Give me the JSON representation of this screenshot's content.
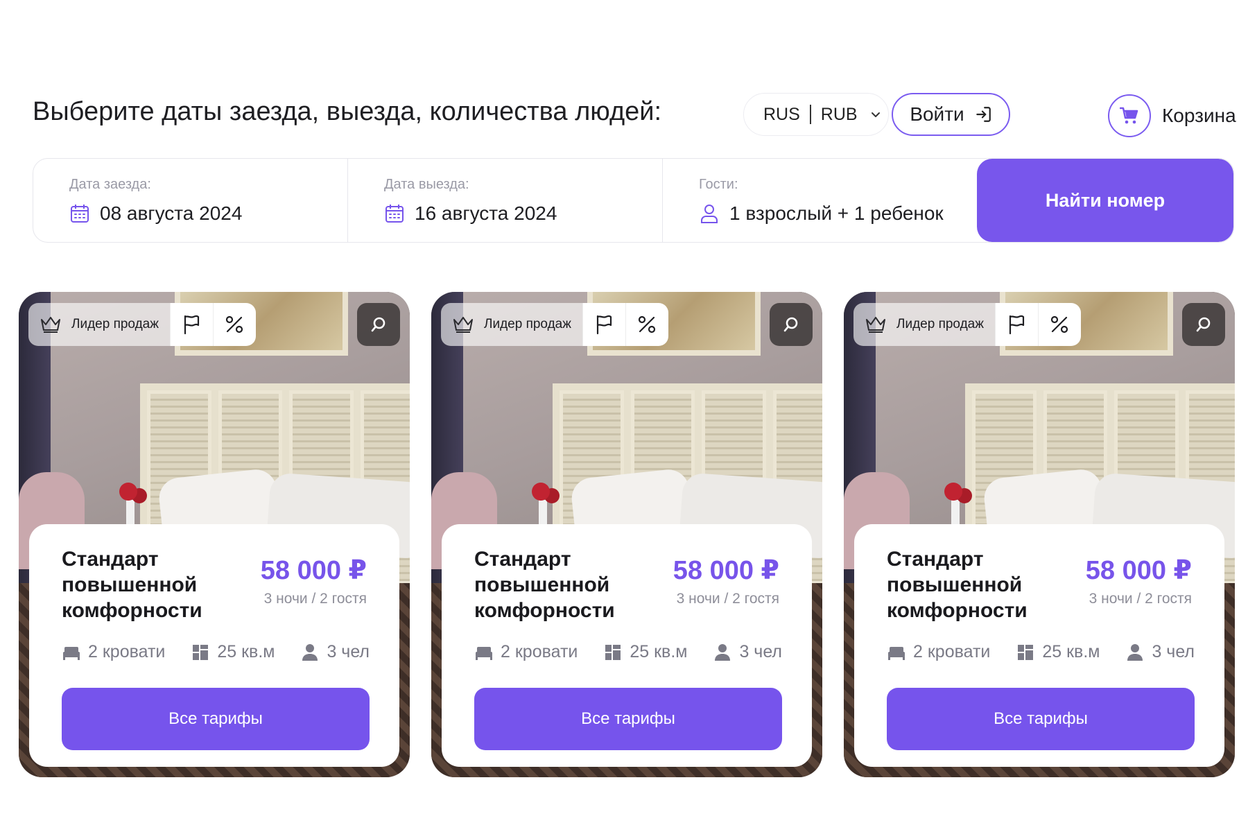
{
  "header": {
    "heading": "Выберите даты заезда, выезда, количества людей:",
    "language": "RUS",
    "currency": "RUB",
    "login_label": "Войти",
    "cart_label": "Корзина"
  },
  "search": {
    "checkin": {
      "label": "Дата заезда:",
      "value": "08 августа 2024",
      "icon": "calendar-icon"
    },
    "checkout": {
      "label": "Дата выезда:",
      "value": "16 августа 2024",
      "icon": "calendar-icon"
    },
    "guests": {
      "label": "Гости:",
      "value": "1 взрослый + 1 ребенок",
      "icon": "user-icon"
    },
    "submit_label": "Найти номер"
  },
  "cards": [
    {
      "badge": "Лидер продаж",
      "title": "Стандарт повышенной комфорности",
      "price": "58 000 ₽",
      "nights": "3 ночи / 2 гостя",
      "beds": "2 кровати",
      "area": "25 кв.м",
      "capacity": "3 чел",
      "button": "Все тарифы"
    },
    {
      "badge": "Лидер продаж",
      "title": "Стандарт повышенной комфорности",
      "price": "58 000 ₽",
      "nights": "3 ночи / 2 гостя",
      "beds": "2 кровати",
      "area": "25 кв.м",
      "capacity": "3 чел",
      "button": "Все тарифы"
    },
    {
      "badge": "Лидер продаж",
      "title": "Стандарт повышенной комфорности",
      "price": "58 000 ₽",
      "nights": "3 ночи / 2 гостя",
      "beds": "2 кровати",
      "area": "25 кв.м",
      "capacity": "3 чел",
      "button": "Все тарифы"
    }
  ],
  "colors": {
    "accent": "#7654ec",
    "price": "#7754ea",
    "text": "#1e1e22",
    "muted": "#8e8e99"
  }
}
